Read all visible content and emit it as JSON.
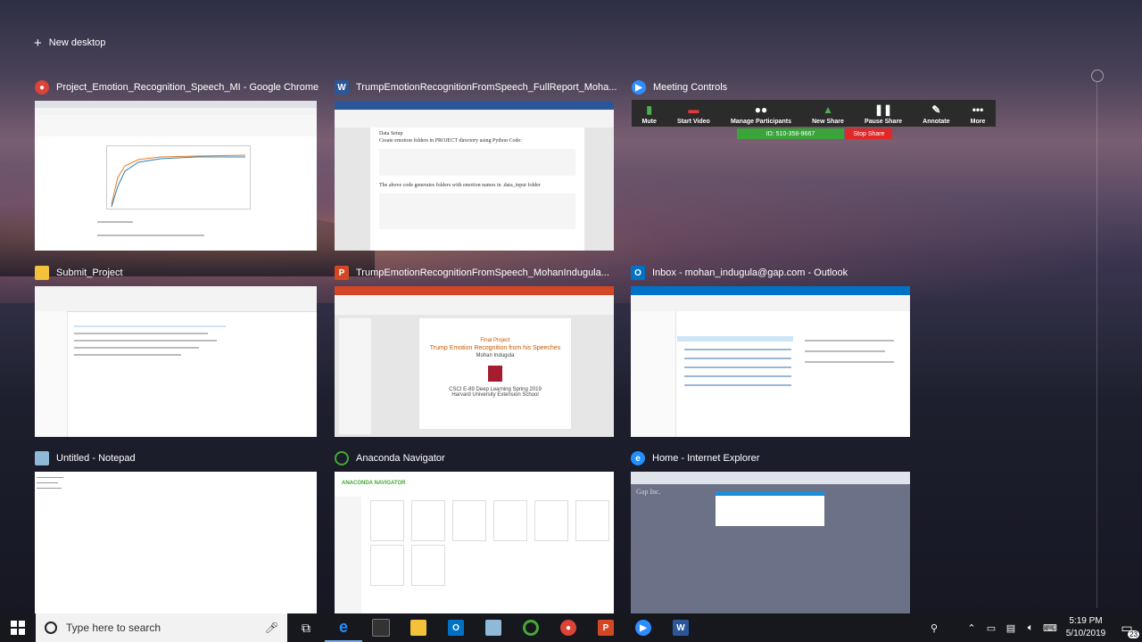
{
  "new_desktop_label": "New desktop",
  "windows": [
    {
      "title": "Project_Emotion_Recognition_Speech_MI - Google Chrome",
      "icon": "chrome-icon"
    },
    {
      "title": "TrumpEmotionRecognitionFromSpeech_FullReport_Moha...",
      "icon": "word-icon",
      "doc_heading": "Data Setup",
      "doc_line1": "Create emotion folders in PROJECT directory using Python Code:",
      "doc_line2": "The above code generates folders with emotion names in .data_input folder"
    },
    {
      "title": "Meeting Controls",
      "icon": "zoom-icon"
    },
    {
      "title": "Submit_Project",
      "icon": "folder-icon"
    },
    {
      "title": "TrumpEmotionRecognitionFromSpeech_MohanIndugula...",
      "icon": "powerpoint-icon",
      "slide_kicker": "Final Project",
      "slide_title": "Trump Emotion Recognition from his Speeches",
      "slide_author": "Mohan Indugula",
      "slide_course": "CSCI E-89 Deep Learning Spring 2019",
      "slide_school": "Harvard University Extension School"
    },
    {
      "title": "Inbox - mohan_indugula@gap.com - Outlook",
      "icon": "outlook-icon"
    },
    {
      "title": "Untitled - Notepad",
      "icon": "notepad-icon"
    },
    {
      "title": "Anaconda Navigator",
      "icon": "anaconda-icon",
      "brand": "ANACONDA NAVIGATOR"
    },
    {
      "title": "Home - Internet Explorer",
      "icon": "ie-icon",
      "page_text": "Gap Inc."
    }
  ],
  "zoom": {
    "controls": [
      "Mute",
      "Start Video",
      "Manage Participants",
      "New Share",
      "Pause Share",
      "Annotate",
      "More"
    ],
    "meeting_id": "ID: 510-358-9667",
    "stop_share": "Stop Share"
  },
  "taskbar": {
    "search_placeholder": "Type here to search",
    "pinned": [
      "ie-icon",
      "terminal-icon",
      "file-explorer-icon",
      "outlook-icon",
      "notepad-icon",
      "anaconda-icon",
      "chrome-icon",
      "powerpoint-icon",
      "zoom-icon",
      "word-icon"
    ],
    "time": "5:19 PM",
    "date": "5/10/2019",
    "notification_count": "23"
  },
  "colors": {
    "chrome": "#db4437",
    "word": "#2b579a",
    "zoom": "#2d8cff",
    "folder": "#f3c13a",
    "powerpoint": "#d24726",
    "outlook": "#0072c6",
    "anaconda": "#44a833",
    "ie": "#1e90ff"
  }
}
